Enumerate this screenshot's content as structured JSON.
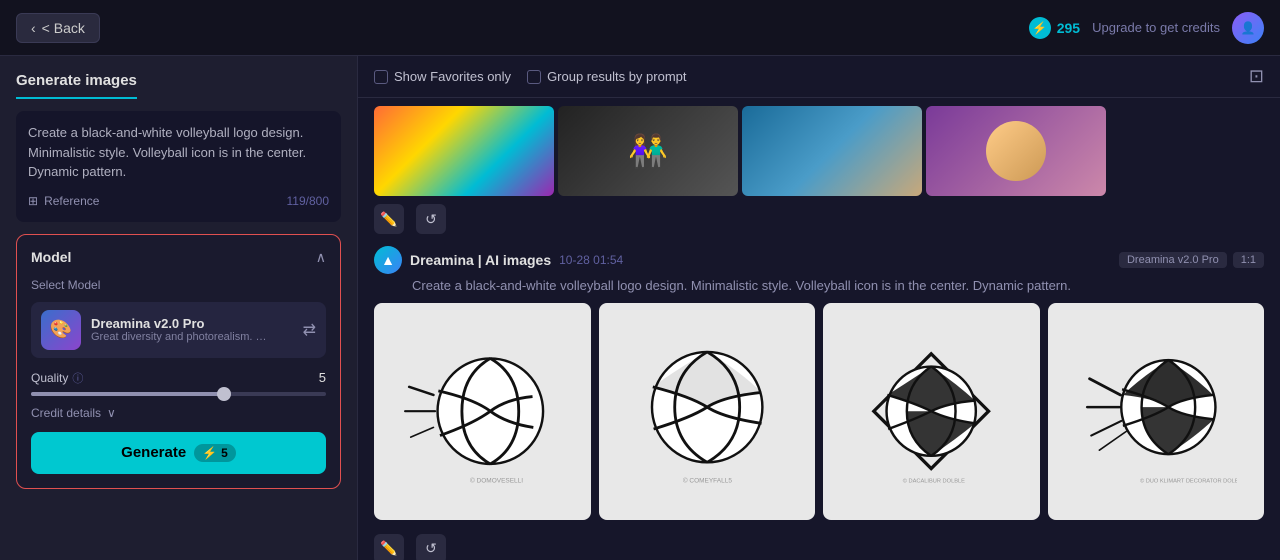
{
  "topbar": {
    "back_label": "< Back",
    "credits_amount": "295",
    "upgrade_label": "Upgrade to get credits"
  },
  "left": {
    "title": "Generate images",
    "prompt": "Create a black-and-white volleyball logo design. Minimalistic style. Volleyball icon is in the center. Dynamic pattern.",
    "char_count": "119/800",
    "reference_label": "Reference",
    "model_section_title": "Model",
    "select_model_label": "Select Model",
    "model_name": "Dreamina v2.0 Pro",
    "model_desc": "Great diversity and photorealism. Of...",
    "quality_label": "Quality",
    "quality_value": "5",
    "credit_details_label": "Credit details",
    "generate_label": "Generate",
    "generate_cost": "5"
  },
  "right": {
    "show_favorites_label": "Show Favorites only",
    "group_results_label": "Group results by prompt",
    "ai_title": "Dreamina | AI images",
    "ai_timestamp": "10-28  01:54",
    "ai_prompt": "Create a black-and-white volleyball logo design. Minimalistic style. Volleyball icon is in the center. Dynamic pattern.",
    "model_badge": "Dreamina v2.0 Pro",
    "ratio_badge": "1:1"
  }
}
